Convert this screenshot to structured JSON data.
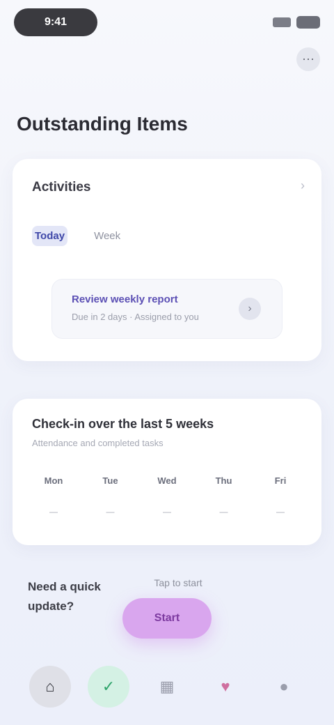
{
  "status": {
    "time": "9:41"
  },
  "header": {
    "menu_icon": "more-icon"
  },
  "page": {
    "title": "Outstanding Items"
  },
  "activity": {
    "title": "Activities",
    "more_icon": "chevron-right-icon",
    "segments": [
      {
        "label": "Today",
        "active": true
      },
      {
        "label": "Week",
        "active": false
      }
    ],
    "item": {
      "title": "Review weekly report",
      "subtitle": "Due in 2 days · Assigned to you"
    }
  },
  "weekly": {
    "title": "Check-in over the last 5 weeks",
    "subtitle": "Attendance and completed tasks",
    "days": [
      {
        "label": "Mon",
        "value": "—"
      },
      {
        "label": "Tue",
        "value": "—"
      },
      {
        "label": "Wed",
        "value": "—"
      },
      {
        "label": "Thu",
        "value": "—"
      },
      {
        "label": "Fri",
        "value": "—"
      }
    ]
  },
  "promo": {
    "text": "Need a quick update?",
    "top_label": "Tap to start",
    "button_label": "Start"
  },
  "tabs": [
    {
      "name": "home-tab",
      "icon": "home-icon"
    },
    {
      "name": "tasks-tab",
      "icon": "check-icon"
    },
    {
      "name": "calendar-tab",
      "icon": "calendar-icon"
    },
    {
      "name": "favorites-tab",
      "icon": "heart-icon"
    },
    {
      "name": "profile-tab",
      "icon": "user-icon"
    }
  ],
  "colors": {
    "accent": "#3e47a8",
    "promo": "#d9a6ee",
    "active_tab": "#d4f1e4"
  }
}
